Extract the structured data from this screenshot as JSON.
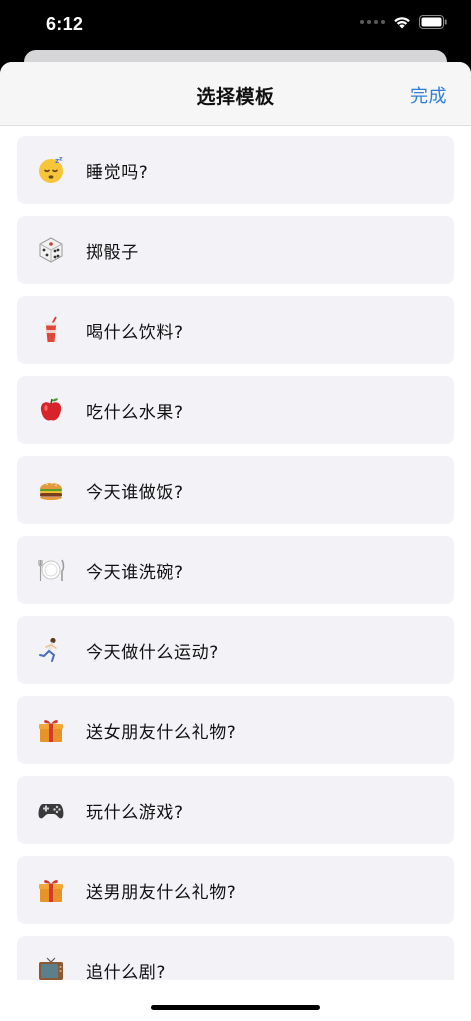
{
  "status_bar": {
    "time": "6:12"
  },
  "nav": {
    "title": "选择模板",
    "done_label": "完成"
  },
  "templates": [
    {
      "icon": "sleeping-face-icon",
      "label": "睡觉吗?"
    },
    {
      "icon": "dice-icon",
      "label": "掷骰子"
    },
    {
      "icon": "cup-with-straw-icon",
      "label": "喝什么饮料?"
    },
    {
      "icon": "red-apple-icon",
      "label": "吃什么水果?"
    },
    {
      "icon": "hamburger-icon",
      "label": "今天谁做饭?"
    },
    {
      "icon": "plate-fork-knife-icon",
      "label": "今天谁洗碗?"
    },
    {
      "icon": "person-running-icon",
      "label": "今天做什么运动?"
    },
    {
      "icon": "wrapped-gift-icon",
      "label": "送女朋友什么礼物?"
    },
    {
      "icon": "video-game-controller-icon",
      "label": "玩什么游戏?"
    },
    {
      "icon": "wrapped-gift-icon",
      "label": "送男朋友什么礼物?"
    },
    {
      "icon": "television-icon",
      "label": "追什么剧?"
    }
  ],
  "colors": {
    "accent": "#2f7fd8",
    "row_background": "#f3f2f7"
  }
}
